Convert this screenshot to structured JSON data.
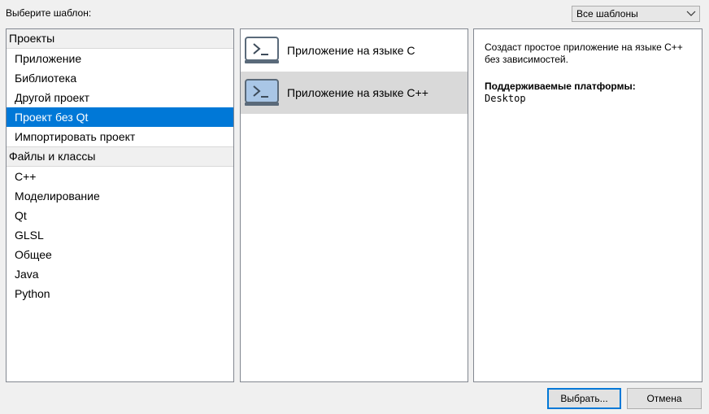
{
  "header": {
    "choose_label": "Выберите шаблон:",
    "filter_value": "Все шаблоны"
  },
  "categories": {
    "projects_header": "Проекты",
    "projects_items": [
      "Приложение",
      "Библиотека",
      "Другой проект",
      "Проект без Qt",
      "Импортировать проект"
    ],
    "selected_index": 3,
    "files_header": "Файлы и классы",
    "files_items": [
      "C++",
      "Моделирование",
      "Qt",
      "GLSL",
      "Общее",
      "Java",
      "Python"
    ]
  },
  "templates": {
    "items": [
      {
        "label": "Приложение на языке C",
        "icon": "terminal-icon"
      },
      {
        "label": "Приложение на языке C++",
        "icon": "terminal-icon"
      }
    ],
    "selected_index": 1
  },
  "description": {
    "text": "Создаст простое приложение на языке C++ без зависимостей.",
    "platforms_title": "Поддерживаемые платформы:",
    "platforms_value": "Desktop"
  },
  "buttons": {
    "choose": "Выбрать...",
    "cancel": "Отмена"
  },
  "colors": {
    "selection": "#0078d7",
    "template_selection": "#d9d9d9"
  }
}
